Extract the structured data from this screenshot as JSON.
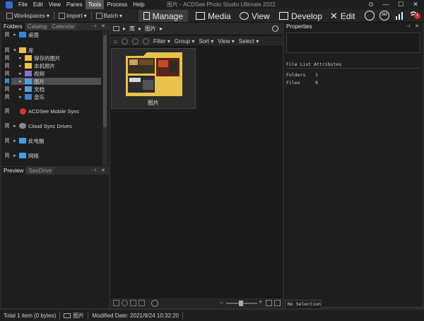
{
  "window": {
    "title": "图片 - ACDSee Photo Studio Ultimate 2022"
  },
  "menu": [
    "File",
    "Edit",
    "View",
    "Panes",
    "Tools",
    "Process",
    "Help"
  ],
  "menu_active": "Tools",
  "toolbar": {
    "workspaces": "Workspaces",
    "import": "Import",
    "batch": "Batch"
  },
  "modes": {
    "manage": "Manage",
    "media": "Media",
    "view": "View",
    "develop": "Develop",
    "edit": "Edit"
  },
  "notification_count": "1",
  "folders_panel": {
    "tabs": [
      "Folders",
      "Catalog",
      "Calendar"
    ],
    "items": [
      {
        "label": "桌面"
      },
      {
        "label": "库"
      },
      {
        "label": "保存的图片"
      },
      {
        "label": "本机照片"
      },
      {
        "label": "视频"
      },
      {
        "label": "图片"
      },
      {
        "label": "文档"
      },
      {
        "label": "音乐"
      },
      {
        "label": "ACDSee Mobile Sync"
      },
      {
        "label": "Cloud Sync Drives"
      },
      {
        "label": "此电脑"
      },
      {
        "label": "网络"
      }
    ]
  },
  "preview_panel": {
    "tabs": [
      "Preview",
      "SeeDrive"
    ]
  },
  "address_bar": {
    "crumbs": [
      "库",
      "图片"
    ]
  },
  "filter_bar": {
    "items": [
      "Filter",
      "Group",
      "Sort",
      "View",
      "Select"
    ]
  },
  "thumbnail": {
    "caption": "图片"
  },
  "properties": {
    "title": "Properties",
    "section": "File List Attributes",
    "rows": [
      {
        "key": "Folders",
        "value": "1"
      },
      {
        "key": "Files",
        "value": "0"
      }
    ],
    "bottom_tab": "No Selection"
  },
  "statusbar": {
    "total": "Total 1 item  (0 bytes)",
    "current": "图片",
    "modified": "Modified Date: 2021/9/24 10:32:20"
  },
  "colors": {
    "accent_folder": "#e8c24a",
    "notify_badge": "#d62b2b",
    "mobile_sync_red": "#d33"
  }
}
